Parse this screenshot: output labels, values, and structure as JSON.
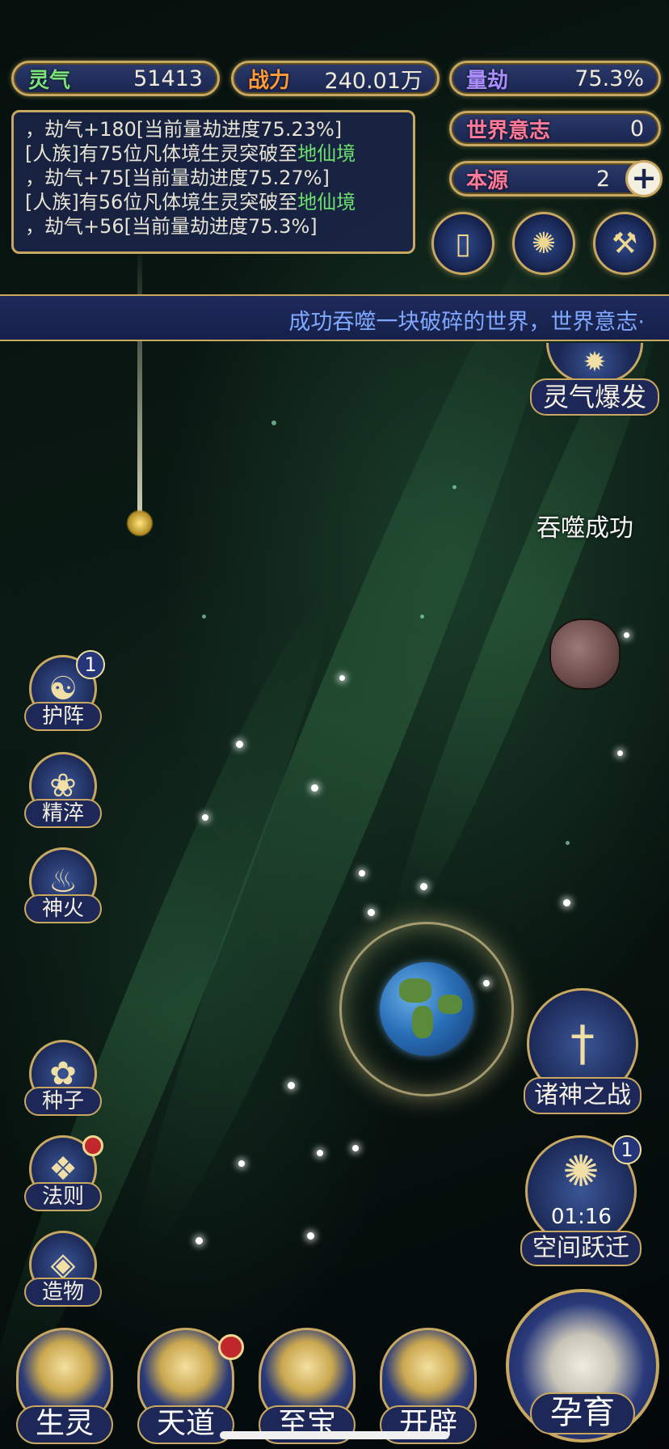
{
  "stats": {
    "lingqi": {
      "label": "灵气",
      "value": "51413"
    },
    "zhanli": {
      "label": "战力",
      "value": "240.01万"
    },
    "liangjie": {
      "label": "量劫",
      "value": "75.3%"
    },
    "shijie_yizhi": {
      "label": "世界意志",
      "value": "0"
    },
    "benyuan": {
      "label": "本源",
      "value": "2"
    }
  },
  "log": [
    {
      "pre": "，劫气+180[当前量劫进度75.23%]",
      "green": "",
      "post": ""
    },
    {
      "pre": "[人族]有75位凡体境生灵突破至",
      "green": "地仙境",
      "post": ""
    },
    {
      "pre": "，劫气+75[当前量劫进度75.27%]",
      "green": "",
      "post": ""
    },
    {
      "pre": "[人族]有56位凡体境生灵突破至",
      "green": "地仙境",
      "post": ""
    },
    {
      "pre": "，劫气+56[当前量劫进度75.3%]",
      "green": "",
      "post": ""
    }
  ],
  "ticker": "成功吞噬一块破碎的世界，世界意志·",
  "float_text": "吞噬成功",
  "buttons": {
    "lingqi_baofa": "灵气爆发",
    "zhushen_zhizhan": "诸神之战",
    "kongjian_yueqian": "空间跃迁",
    "kongjian_timer": "01:16",
    "kongjian_badge": "1"
  },
  "left_column": [
    {
      "label": "护阵",
      "icon": "yin-yang-icon",
      "glyph": "☯",
      "badge": "1"
    },
    {
      "label": "精淬",
      "icon": "lotus-icon",
      "glyph": "❀",
      "badge": ""
    },
    {
      "label": "神火",
      "icon": "flame-icon",
      "glyph": "♨",
      "badge": ""
    },
    {
      "label": "种子",
      "icon": "flower-icon",
      "glyph": "✿",
      "badge": ""
    },
    {
      "label": "法则",
      "icon": "rune-icon",
      "glyph": "❖",
      "badge": "red"
    },
    {
      "label": "造物",
      "icon": "diamond-icon",
      "glyph": "◈",
      "badge": ""
    }
  ],
  "bottom_nav": [
    {
      "label": "生灵",
      "icon": "phoenix-icon"
    },
    {
      "label": "天道",
      "icon": "swirl-icon"
    },
    {
      "label": "至宝",
      "icon": "treasure-icon"
    },
    {
      "label": "开辟",
      "icon": "axe-icon"
    },
    {
      "label": "孕育",
      "icon": "embryo-icon"
    }
  ],
  "colors": {
    "gold": "#c8a860",
    "panel": "#1d2858",
    "green_text": "#6ee06e",
    "ticker_text": "#7fa8ff"
  }
}
